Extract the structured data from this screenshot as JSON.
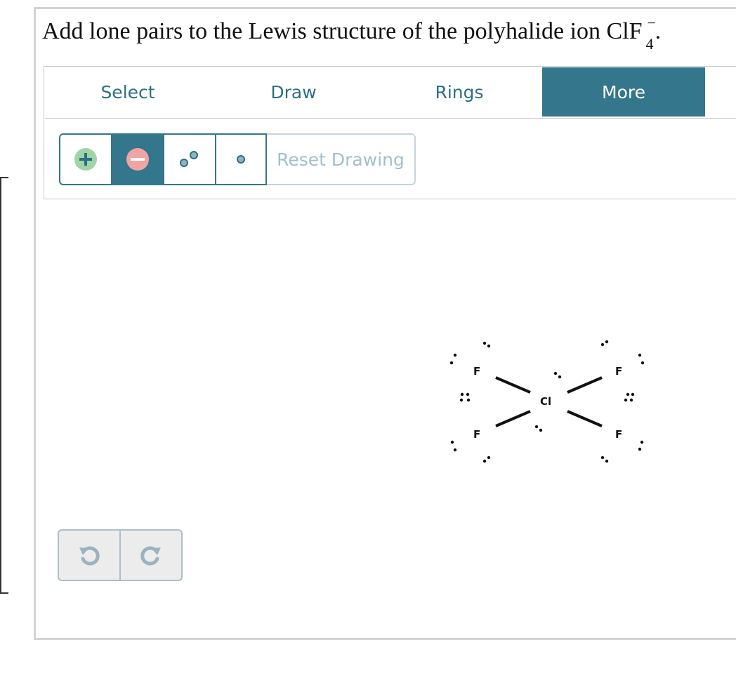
{
  "question": {
    "text": "Add lone pairs to the Lewis structure of the polyhalide ion",
    "formula_main": "ClF",
    "formula_subscript": "4",
    "formula_charge": "−",
    "period": "."
  },
  "tabs": [
    {
      "label": "Select",
      "active": false
    },
    {
      "label": "Draw",
      "active": false
    },
    {
      "label": "Rings",
      "active": false
    },
    {
      "label": "More",
      "active": true
    }
  ],
  "toolbar": {
    "tools": [
      {
        "icon": "plus-charge-icon",
        "color": "#9fd3a8"
      },
      {
        "icon": "minus-charge-icon",
        "color": "#f2a3a3",
        "selected": true
      },
      {
        "icon": "lone-pair-icon"
      },
      {
        "icon": "single-electron-icon"
      }
    ],
    "reset_label": "Reset Drawing"
  },
  "history": {
    "undo_icon": "undo-icon",
    "redo_icon": "redo-icon"
  },
  "molecule": {
    "center": "Cl",
    "ligands": [
      "F",
      "F",
      "F",
      "F"
    ]
  },
  "colors": {
    "accent": "#34768c",
    "accent_text": "#2e6f84",
    "disabled_text": "#9fc1cd"
  }
}
